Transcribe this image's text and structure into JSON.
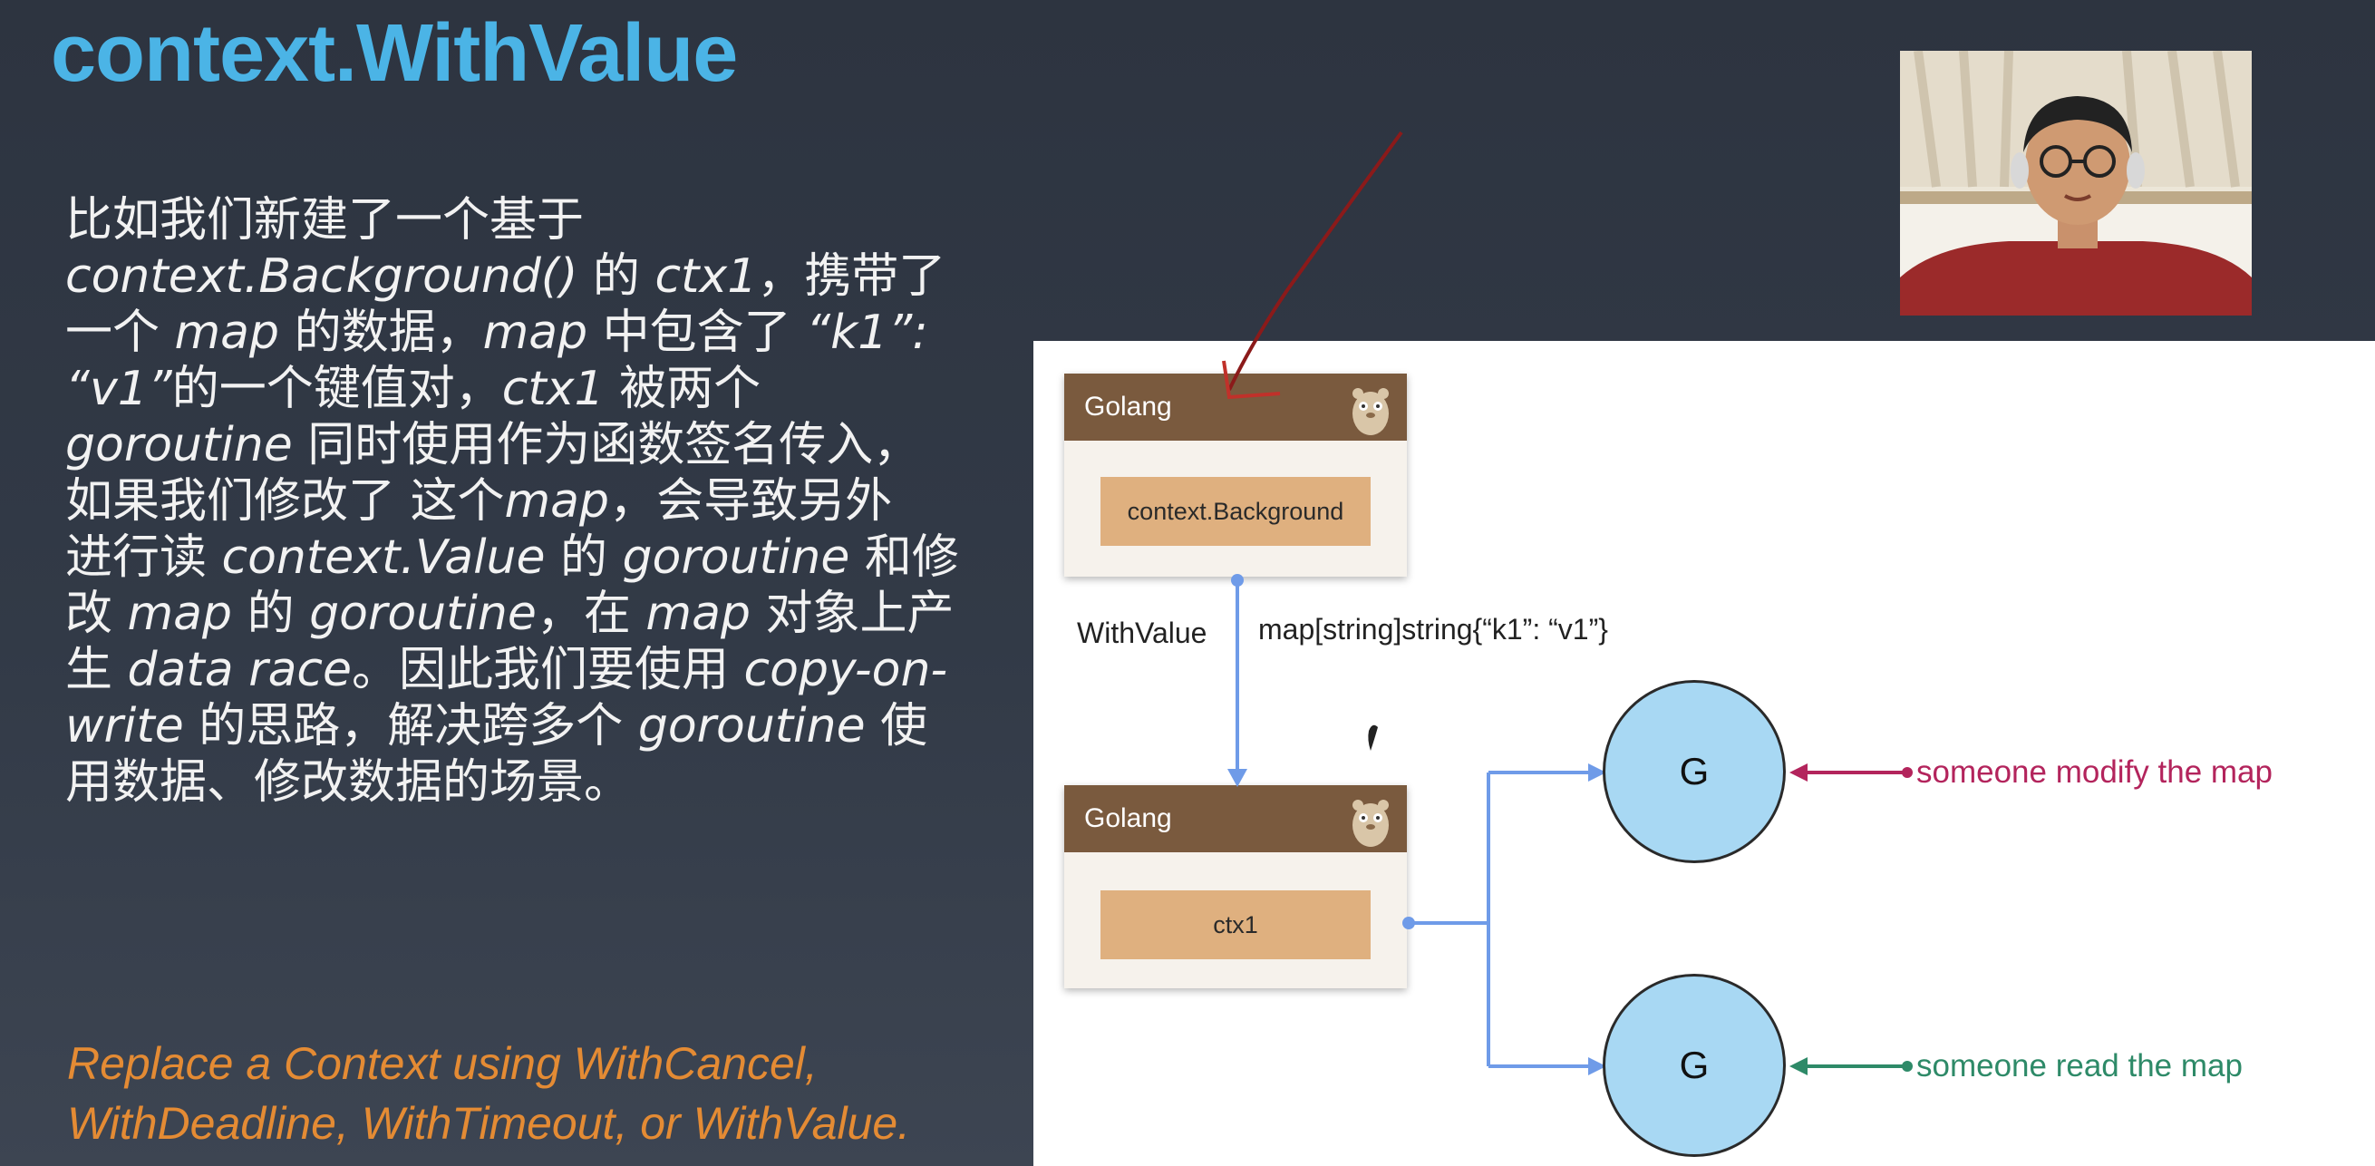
{
  "slide": {
    "title": "context.WithValue",
    "body_lines": [
      [
        "比如我们新建了一个基于"
      ],
      [
        "context.Background()",
        " 的 ",
        "ctx1",
        "，携带了"
      ],
      [
        "一个 ",
        "map",
        " 的数据，",
        "map",
        " 中包含了 ",
        "“k1”:"
      ],
      [
        "“v1”",
        "的一个键值对，",
        "ctx1",
        " 被两个"
      ],
      [
        "goroutine",
        " 同时使用作为函数签名传入，"
      ],
      [
        "如果我们修改了 这个",
        "map",
        "，会导致另外"
      ],
      [
        "进行读 ",
        "context.Value",
        " 的 ",
        "goroutine",
        " 和修"
      ],
      [
        "改 ",
        "map",
        " 的 ",
        "goroutine",
        "，在 ",
        "map",
        " 对象上产"
      ],
      [
        "生 ",
        "data race",
        "。因此我们要使用 ",
        "copy-on-"
      ],
      [
        "write",
        " 的思路，解决跨多个 ",
        "goroutine",
        " 使"
      ],
      [
        "用数据、修改数据的场景。"
      ]
    ],
    "footnote_lines": [
      "Replace a Context using WithCancel,",
      "WithDeadline, WithTimeout, or WithValue."
    ]
  },
  "diagram": {
    "top_card": {
      "header": "Golang",
      "box": "context.Background"
    },
    "edge_label": "WithValue",
    "edge_value": "map[string]string{“k1”: “v1”}",
    "bottom_card": {
      "header": "Golang",
      "box": "ctx1"
    },
    "goroutine_top": {
      "label": "G",
      "note": "someone modify the map"
    },
    "goroutine_bottom": {
      "label": "G",
      "note": "someone read the map"
    }
  },
  "colors": {
    "title": "#4bb4e6",
    "footnote": "#e48b34",
    "card_header": "#7a5a3e",
    "card_box": "#dfb07f",
    "circle": "#a8d8f3",
    "connector": "#6f9be8",
    "modify_arrow": "#b3245c",
    "read_arrow": "#2e8a68",
    "annotation": "#8b1a1a"
  }
}
